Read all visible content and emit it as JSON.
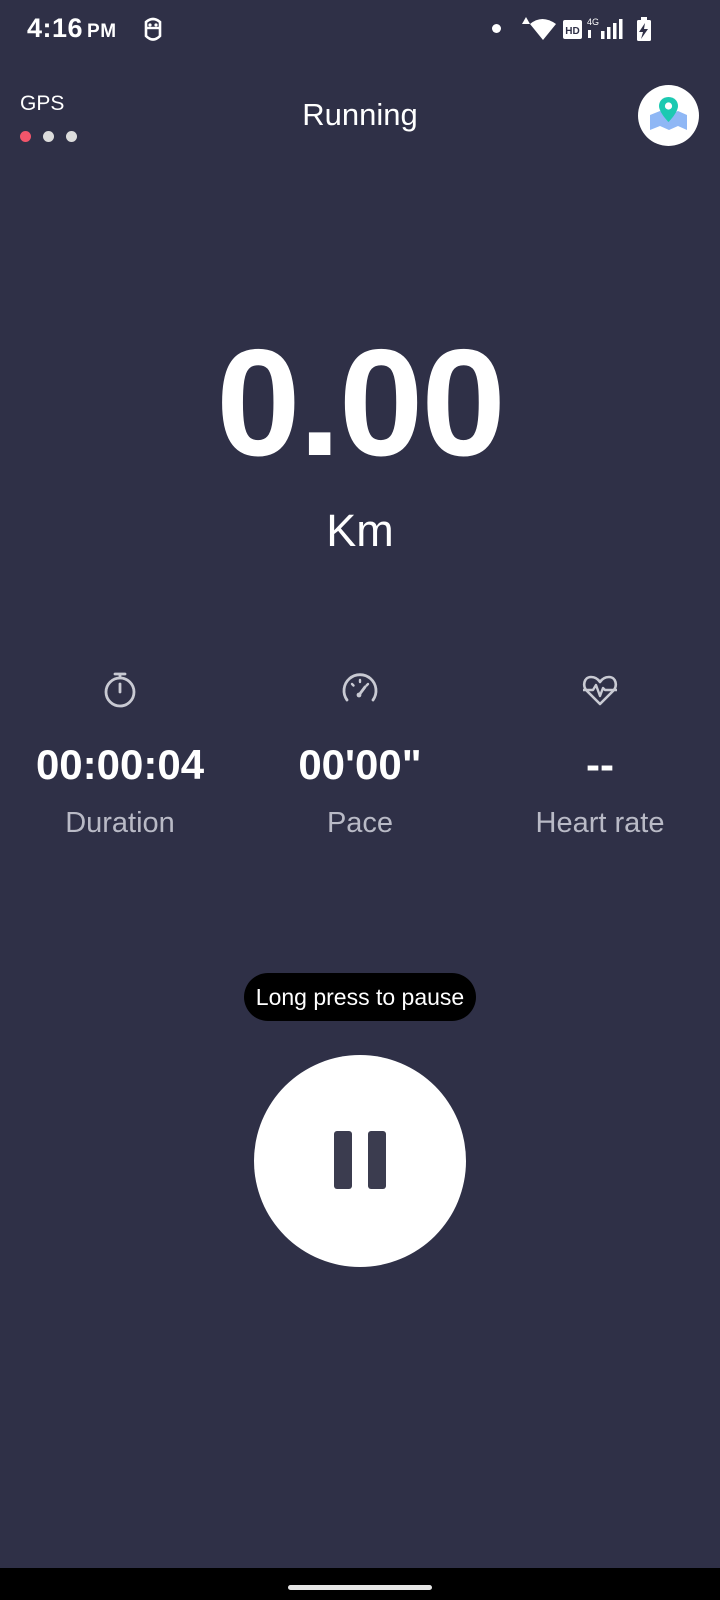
{
  "status_bar": {
    "time": "4:16",
    "ampm": "PM",
    "network": "4G",
    "hd_label": "HD"
  },
  "header": {
    "gps_label": "GPS",
    "gps_signal_level": 1,
    "gps_signal_max": 3,
    "title": "Running",
    "map_icon": "map-pin-icon"
  },
  "distance": {
    "value": "0.00",
    "unit": "Km"
  },
  "metrics": [
    {
      "icon": "stopwatch-icon",
      "value": "00:00:04",
      "label": "Duration"
    },
    {
      "icon": "speedometer-icon",
      "value": "00'00\"",
      "label": "Pace"
    },
    {
      "icon": "heart-rate-icon",
      "value": "--",
      "label": "Heart rate"
    }
  ],
  "controls": {
    "hint": "Long press to pause",
    "pause_icon": "pause-icon"
  },
  "colors": {
    "background": "#2f3047",
    "gps_active": "#f2556b",
    "map_pin": "#1cc9b1",
    "map_fill": "#8fb7f5"
  }
}
